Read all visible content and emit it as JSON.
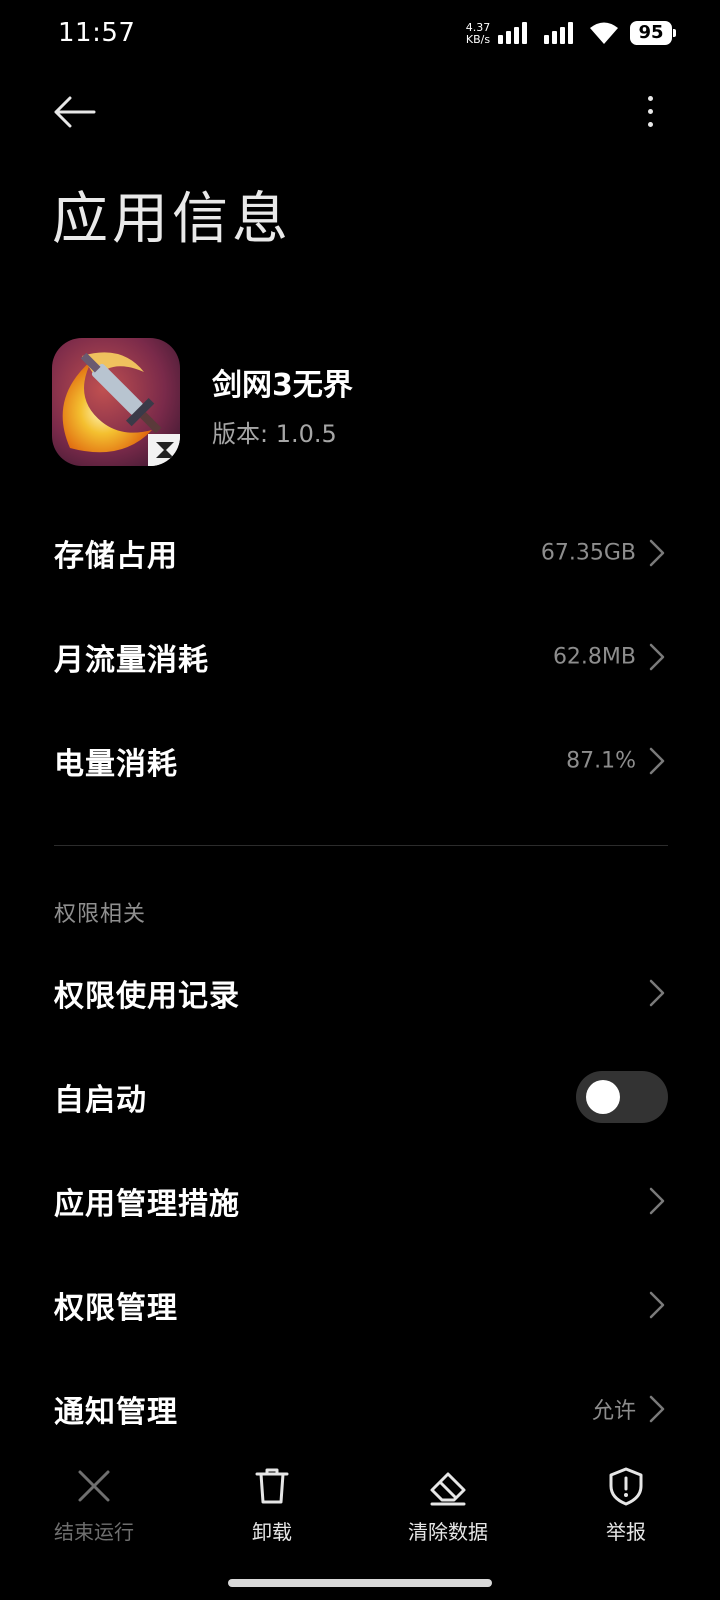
{
  "status_bar": {
    "time": "11:57",
    "net_speed_value": "4.37",
    "net_speed_unit": "KB/s",
    "battery_level": "95"
  },
  "header": {
    "title": "应用信息"
  },
  "app": {
    "name": "剑网3无界",
    "version": "版本: 1.0.5"
  },
  "usage_rows": [
    {
      "label": "存储占用",
      "value": "67.35GB"
    },
    {
      "label": "月流量消耗",
      "value": "62.8MB"
    },
    {
      "label": "电量消耗",
      "value": "87.1%"
    }
  ],
  "permissions": {
    "section_title": "权限相关",
    "rows": [
      {
        "label": "权限使用记录",
        "value": ""
      },
      {
        "label": "自启动",
        "toggle_on": false
      },
      {
        "label": "应用管理措施",
        "value": ""
      },
      {
        "label": "权限管理",
        "value": ""
      },
      {
        "label": "通知管理",
        "value": "允许"
      }
    ]
  },
  "actions": [
    {
      "label": "结束运行",
      "icon": "close-icon",
      "enabled": false
    },
    {
      "label": "卸载",
      "icon": "trash-icon",
      "enabled": true
    },
    {
      "label": "清除数据",
      "icon": "eraser-icon",
      "enabled": true
    },
    {
      "label": "举报",
      "icon": "shield-alert-icon",
      "enabled": true
    }
  ],
  "colors": {
    "background": "#000000",
    "primary_text": "#ffffff",
    "secondary_text": "#8d8d8d",
    "toggle_off_track": "#333333"
  }
}
